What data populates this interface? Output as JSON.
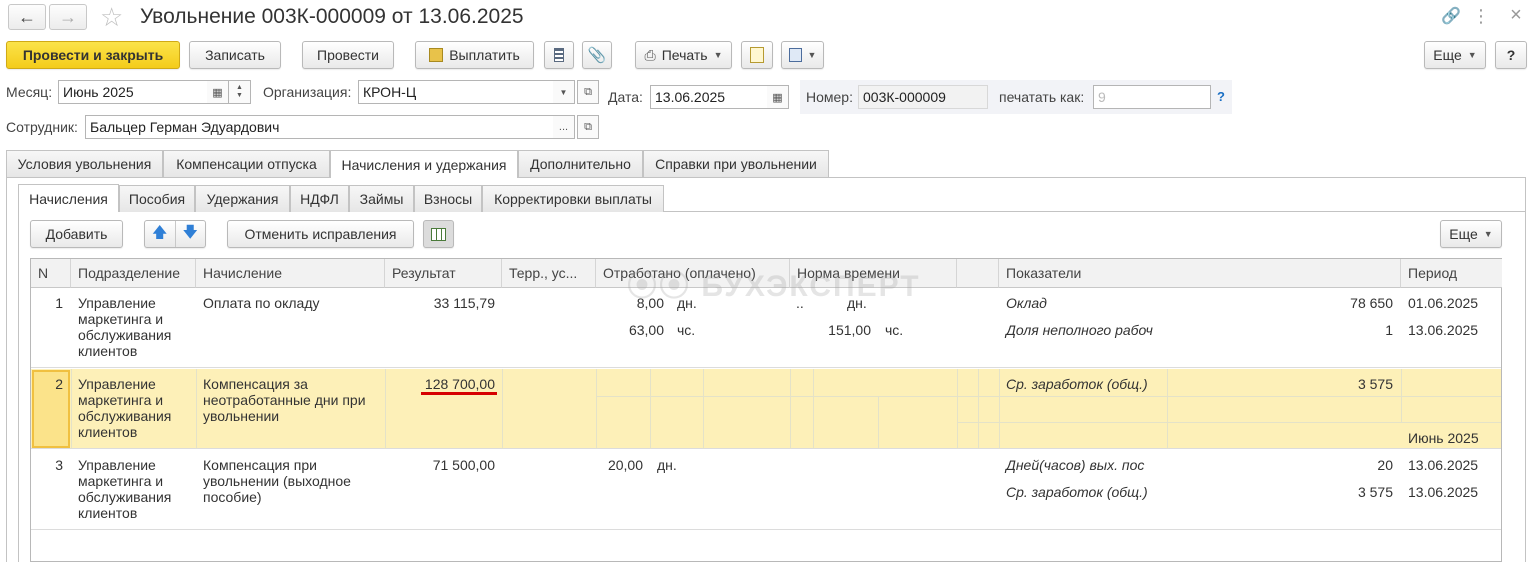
{
  "window": {
    "title": "Увольнение 003К-000009 от 13.06.2025"
  },
  "toolbar": {
    "post_close": "Провести и закрыть",
    "save": "Записать",
    "post": "Провести",
    "pay": "Выплатить",
    "print": "Печать",
    "more": "Еще",
    "help": "?"
  },
  "form": {
    "month_label": "Месяц:",
    "month_value": "Июнь 2025",
    "org_label": "Организация:",
    "org_value": "КРОН-Ц",
    "date_label": "Дата:",
    "date_value": "13.06.2025",
    "number_label": "Номер:",
    "number_value": "003К-000009",
    "print_as_label": "печатать как:",
    "print_as_placeholder": "9",
    "help_q": "?",
    "employee_label": "Сотрудник:",
    "employee_value": "Бальцер Герман Эдуардович"
  },
  "tabs": [
    "Условия увольнения",
    "Компенсации отпуска",
    "Начисления и удержания",
    "Дополнительно",
    "Справки при увольнении"
  ],
  "subtabs": [
    "Начисления",
    "Пособия",
    "Удержания",
    "НДФЛ",
    "Займы",
    "Взносы",
    "Корректировки выплаты"
  ],
  "table_toolbar": {
    "add": "Добавить",
    "cancel_fix": "Отменить исправления",
    "more": "Еще"
  },
  "watermark": "БУХЭКСПЕРТ",
  "table": {
    "columns": [
      "N",
      "Подразделение",
      "Начисление",
      "Результат",
      "Терр., ус...",
      "Отработано (оплачено)",
      "Норма времени",
      "Показатели",
      "Период"
    ],
    "rows": [
      {
        "n": "1",
        "dept": "Управление маркетинга и обслуживания клиентов",
        "accrual": "Оплата по окладу",
        "result": "33 115,79",
        "worked": [
          "8,00",
          "63,00"
        ],
        "worked_units": [
          "дн.",
          "чс."
        ],
        "norm_dot": "..",
        "norm": [
          "",
          "151,00"
        ],
        "norm_units": [
          "дн.",
          "чс."
        ],
        "indicators": [
          "Оклад",
          "Доля неполного рабоч"
        ],
        "ind_values": [
          "78 650",
          "1"
        ],
        "period": [
          "01.06.2025",
          "13.06.2025"
        ]
      },
      {
        "n": "2",
        "dept": "Управление маркетинга и обслуживания клиентов",
        "accrual": "Компенсация за неотработанные дни при увольнении",
        "result": "128 700,00",
        "indicators": [
          "Ср. заработок (общ.)"
        ],
        "ind_values": [
          "3 575"
        ],
        "period": [
          "Июнь 2025"
        ]
      },
      {
        "n": "3",
        "dept": "Управление маркетинга и обслуживания клиентов",
        "accrual": "Компенсация при увольнении (выходное пособие)",
        "result": "71 500,00",
        "worked": [
          "20,00"
        ],
        "worked_units": [
          "дн."
        ],
        "indicators": [
          "Дней(часов) вых. пос",
          "Ср. заработок (общ.)"
        ],
        "ind_values": [
          "20",
          "3 575"
        ],
        "period": [
          "13.06.2025",
          "13.06.2025"
        ]
      }
    ]
  },
  "colors": {
    "primary_button": "#f4cc1a",
    "selected_row": "#fdf0b8",
    "highlight_underline": "#d60000",
    "link_help": "#1a6fc4"
  }
}
